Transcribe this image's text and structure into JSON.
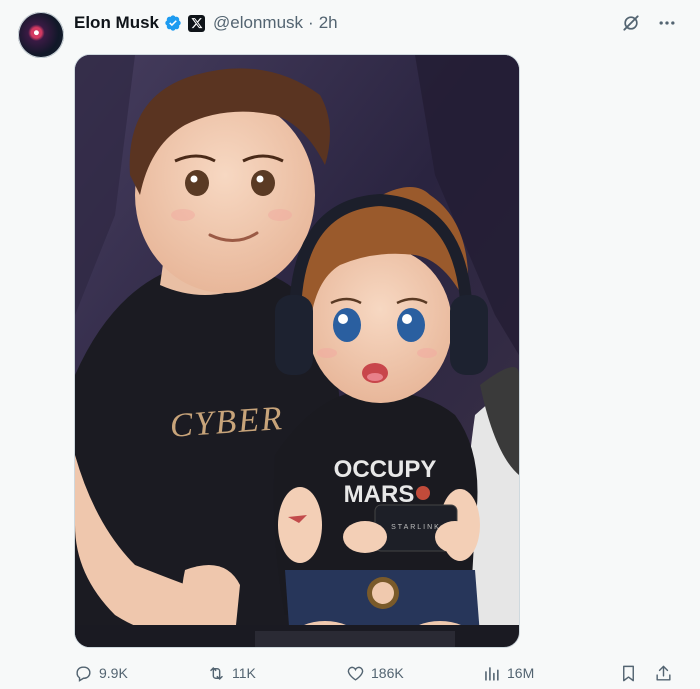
{
  "post": {
    "author_name": "Elon Musk",
    "author_handle": "@elonmusk",
    "separator": "·",
    "timestamp": "2h"
  },
  "image": {
    "shirt_left_text": "CYBER",
    "shirt_child_line1": "OCCUPY",
    "shirt_child_line2": "MARS",
    "controller_text": "STARLINK"
  },
  "actions": {
    "replies": "9.9K",
    "reposts": "11K",
    "likes": "186K",
    "views": "16M"
  },
  "icons": [
    "verified-icon",
    "x-affiliate-icon",
    "grok-icon",
    "more-icon",
    "reply-icon",
    "repost-icon",
    "like-icon",
    "views-icon",
    "bookmark-icon",
    "share-icon"
  ],
  "colors": {
    "verified": "#1d9bf0",
    "text_secondary": "#536471",
    "background": "#f7f9f9"
  }
}
